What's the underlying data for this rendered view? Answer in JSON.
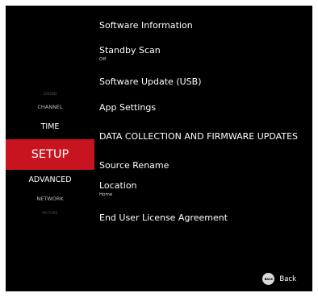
{
  "sidebar": {
    "items": [
      {
        "label": "SOUND"
      },
      {
        "label": "CHANNEL"
      },
      {
        "label": "TIME"
      },
      {
        "label": "SETUP"
      },
      {
        "label": "ADVANCED"
      },
      {
        "label": "NETWORK"
      },
      {
        "label": "PICTURE"
      }
    ],
    "active_color": "#c8141e"
  },
  "menu": {
    "items": [
      {
        "label": "Software Information",
        "value": ""
      },
      {
        "label": "Standby Scan",
        "value": "Off"
      },
      {
        "label": "Software Update (USB)",
        "value": ""
      },
      {
        "label": "App Settings",
        "value": ""
      },
      {
        "label": "DATA COLLECTION AND FIRMWARE UPDATES",
        "value": ""
      },
      {
        "label": "Source Rename",
        "value": ""
      },
      {
        "label": "Location",
        "value": "Home"
      },
      {
        "label": "End User License Agreement",
        "value": ""
      }
    ]
  },
  "footer": {
    "back_icon_text": "BACK",
    "back_label": "Back"
  }
}
